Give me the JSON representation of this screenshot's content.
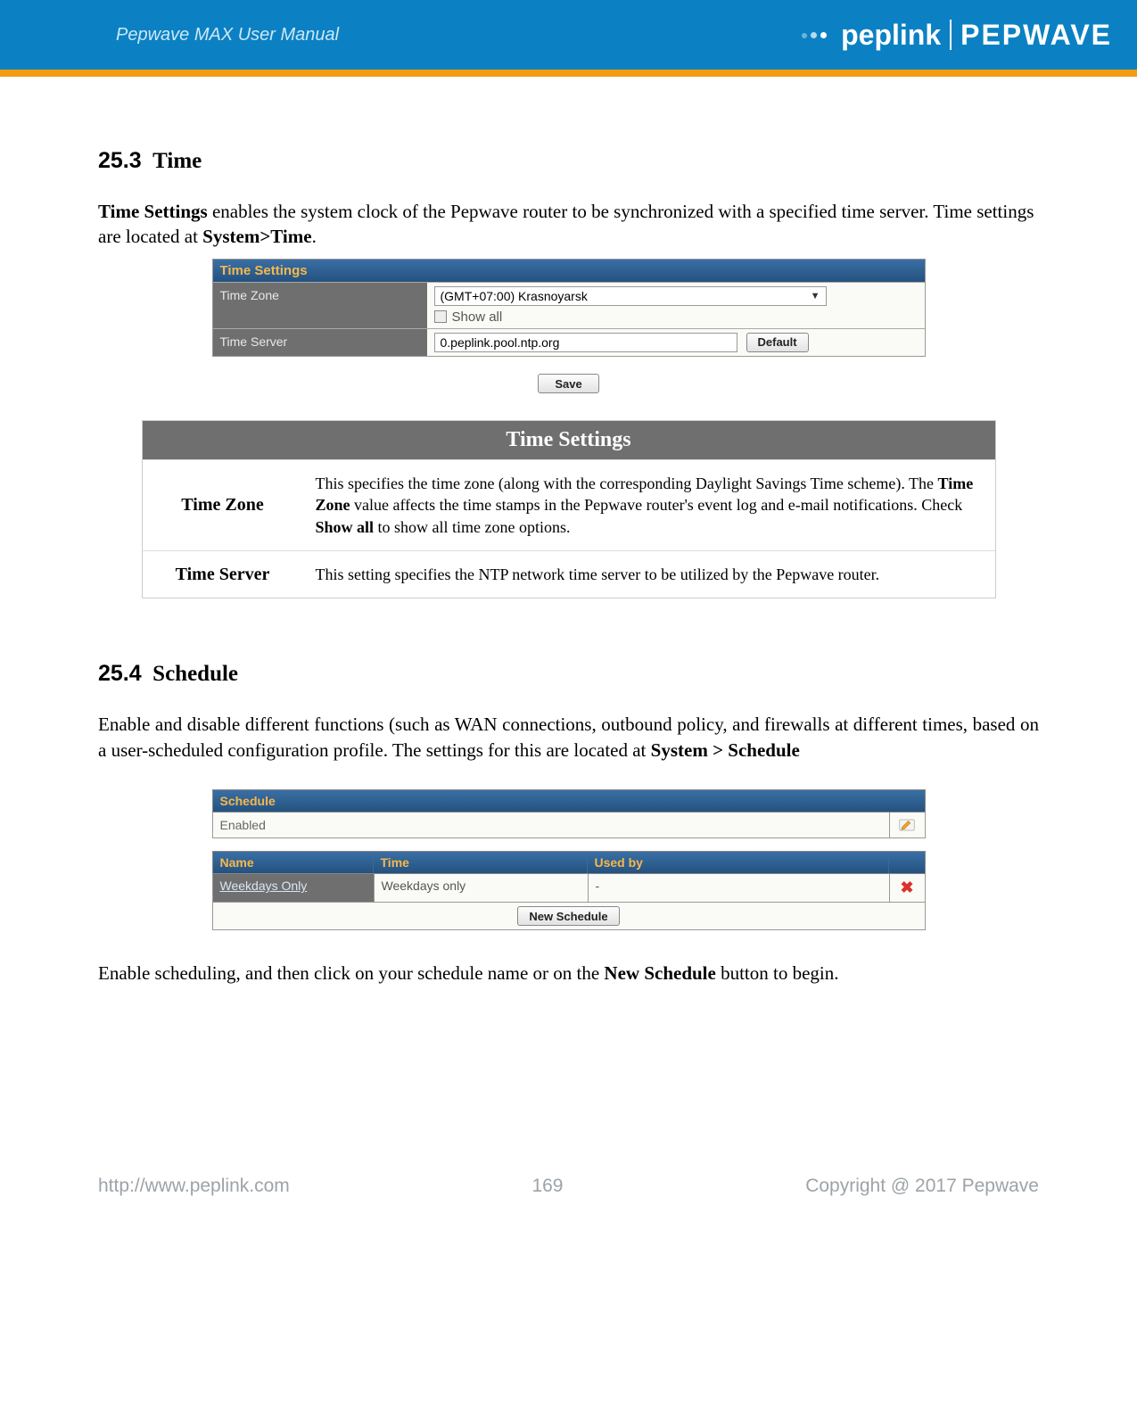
{
  "header": {
    "manual_title": "Pepwave MAX User Manual",
    "brand_left": "peplink",
    "brand_right": "PEPWAVE"
  },
  "section_time": {
    "number": "25.3",
    "title": "Time",
    "intro_prefix": "Time Settings",
    "intro_middle": " enables the system clock of the Pepwave router to be synchronized with a specified time server. Time settings are located at ",
    "intro_path": "System>Time",
    "intro_suffix": "."
  },
  "time_settings_ui": {
    "panel_title": "Time Settings",
    "row_timezone_label": "Time Zone",
    "timezone_selected": "(GMT+07:00) Krasnoyarsk",
    "showall_label": "Show all",
    "row_timeserver_label": "Time Server",
    "timeserver_value": "0.peplink.pool.ntp.org",
    "default_btn": "Default",
    "save_btn": "Save"
  },
  "time_settings_explain": {
    "caption": "Time Settings",
    "rows": [
      {
        "label": "Time Zone",
        "desc_pre": "This specifies the time zone (along with the corresponding Daylight Savings Time scheme). The ",
        "bold1": "Time Zone",
        "desc_mid": " value affects the time stamps in the Pepwave router's event log and e-mail notifications. Check ",
        "bold2": "Show all",
        "desc_post": " to show all time zone options."
      },
      {
        "label": "Time Server",
        "desc": "This setting specifies the NTP network time server to be utilized by the Pepwave router."
      }
    ]
  },
  "section_schedule": {
    "number": "25.4",
    "title": "Schedule",
    "para_pre": "Enable and disable different functions (such as WAN connections, outbound policy, and firewalls at different times, based on a user-scheduled configuration profile. The settings for this are located at ",
    "para_path": "System > Schedule"
  },
  "schedule_ui": {
    "panel_title": "Schedule",
    "enabled_label": "Enabled",
    "col_name": "Name",
    "col_time": "Time",
    "col_usedby": "Used by",
    "row_name": "Weekdays Only",
    "row_time": "Weekdays only",
    "row_usedby": "-",
    "new_btn": "New Schedule"
  },
  "schedule_footer_line": {
    "pre": "Enable scheduling, and then click on your schedule name or on the ",
    "bold": "New Schedule",
    "post": " button to begin."
  },
  "footer": {
    "url": "http://www.peplink.com",
    "page": "169",
    "copyright": "Copyright @ 2017 Pepwave"
  }
}
